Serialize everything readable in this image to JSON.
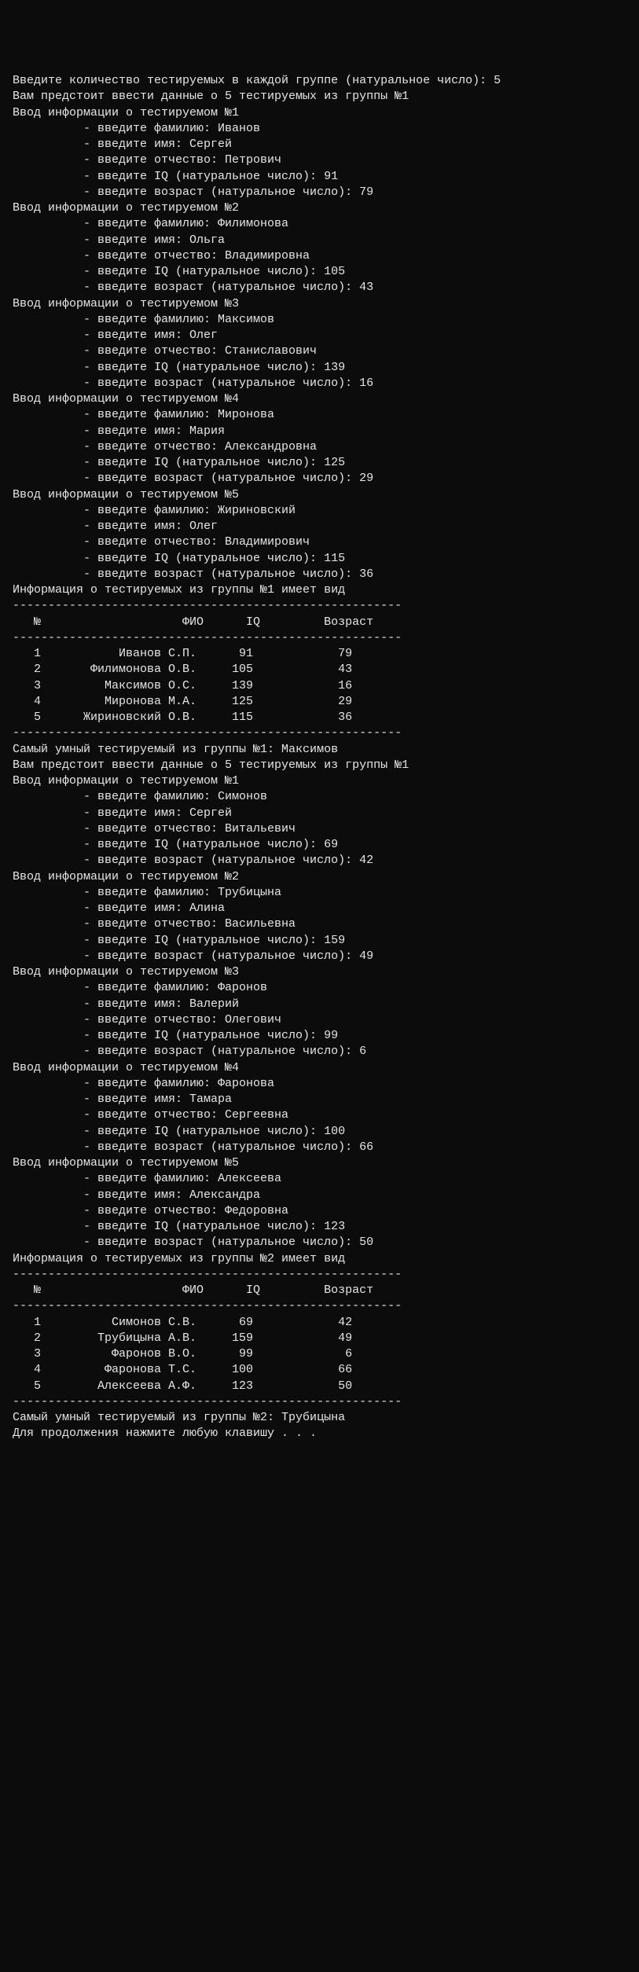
{
  "prompts": {
    "enter_count": "Введите количество тестируемых в каждой группе (натуральное число): ",
    "count_value": "5",
    "group_intro_1": "Вам предстоит ввести данные о 5 тестируемых из группы №1",
    "group_intro_2": "Вам предстоит ввести данные о 5 тестируемых из группы №1",
    "entry_header": "Ввод информации о тестируемом №",
    "surname": "- введите фамилию: ",
    "name": "- введите имя: ",
    "patronymic": "- введите отчество: ",
    "iq": "- введите IQ (натуральное число): ",
    "age": "- введите возраст (натуральное число): ",
    "table_header_1": "Информация о тестируемых из группы №1 имеет вид",
    "table_header_2": "Информация о тестируемых из группы №2 имеет вид",
    "sep": "-------------------------------------------------------",
    "col_no": "№",
    "col_fio": "ФИО",
    "col_iq": "IQ",
    "col_age": "Возраст",
    "smartest_1": "Самый умный тестируемый из группы №1: Максимов",
    "smartest_2": "Самый умный тестируемый из группы №2: Трубицына",
    "continue": "Для продолжения нажмите любую клавишу . . ."
  },
  "group1": {
    "subjects": [
      {
        "n": "1",
        "surname": "Иванов",
        "name": "Сергей",
        "patronymic": "Петрович",
        "iq": "91",
        "age": "79",
        "fio": "Иванов С.П."
      },
      {
        "n": "2",
        "surname": "Филимонова",
        "name": "Ольга",
        "patronymic": "Владимировна",
        "iq": "105",
        "age": "43",
        "fio": "Филимонова О.В."
      },
      {
        "n": "3",
        "surname": "Максимов",
        "name": "Олег",
        "patronymic": "Станиславович",
        "iq": "139",
        "age": "16",
        "fio": "Максимов О.С."
      },
      {
        "n": "4",
        "surname": "Миронова",
        "name": "Мария",
        "patronymic": "Александровна",
        "iq": "125",
        "age": "29",
        "fio": "Миронова М.А."
      },
      {
        "n": "5",
        "surname": "Жириновский",
        "name": "Олег",
        "patronymic": "Владимирович",
        "iq": "115",
        "age": "36",
        "fio": "Жириновский О.В."
      }
    ]
  },
  "group2": {
    "subjects": [
      {
        "n": "1",
        "surname": "Симонов",
        "name": "Сергей",
        "patronymic": "Витальевич",
        "iq": "69",
        "age": "42",
        "fio": "Симонов С.В."
      },
      {
        "n": "2",
        "surname": "Трубицына",
        "name": "Алина",
        "patronymic": "Васильевна",
        "iq": "159",
        "age": "49",
        "fio": "Трубицына А.В."
      },
      {
        "n": "3",
        "surname": "Фаронов",
        "name": "Валерий",
        "patronymic": "Олегович",
        "iq": "99",
        "age": "6",
        "fio": "Фаронов В.О."
      },
      {
        "n": "4",
        "surname": "Фаронова",
        "name": "Тамара",
        "patronymic": "Сергеевна",
        "iq": "100",
        "age": "66",
        "fio": "Фаронова Т.С."
      },
      {
        "n": "5",
        "surname": "Алексеева",
        "name": "Александра",
        "patronymic": "Федоровна",
        "iq": "123",
        "age": "50",
        "fio": "Алексеева А.Ф."
      }
    ]
  }
}
